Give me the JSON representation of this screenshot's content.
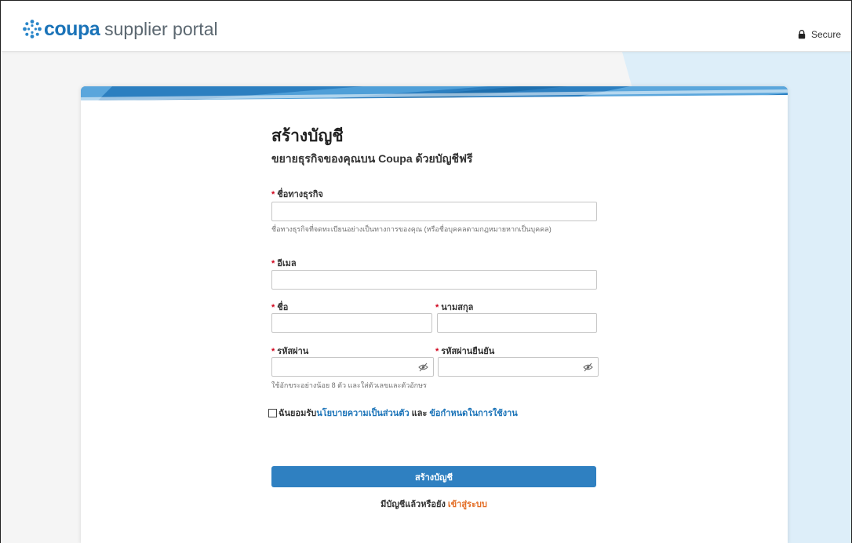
{
  "header": {
    "brand": "coupa",
    "portal": "supplier portal",
    "secure_label": "Secure"
  },
  "form": {
    "title": "สร้างบัญชี",
    "subtitle": "ขยายธุรกิจของคุณบน Coupa ด้วยบัญชีฟรี",
    "business_name_label": "ชื่อทางธุรกิจ",
    "business_name_value": "",
    "business_name_hint": "ชื่อทางธุรกิจที่จดทะเบียนอย่างเป็นทางการของคุณ (หรือชื่อบุคคลตามกฎหมายหากเป็นบุคคล)",
    "email_label": "อีเมล",
    "email_value": "",
    "first_name_label": "ชื่อ",
    "first_name_value": "",
    "last_name_label": "นามสกุล",
    "last_name_value": "",
    "password_label": "รหัสผ่าน",
    "password_value": "",
    "confirm_password_label": "รหัสผ่านยืนยัน",
    "confirm_password_value": "",
    "password_hint": "ใช้อักขระอย่างน้อย 8 ตัว และใส่ตัวเลขและตัวอักษร",
    "terms_prefix": "ฉันยอมรับ",
    "privacy_link": "นโยบายความเป็นส่วนตัว",
    "terms_and": "และ",
    "terms_link": "ข้อกำหนดในการใช้งาน",
    "terms_checked": false,
    "submit_label": "สร้างบัญชี",
    "signin_prefix": "มีบัญชีแล้วหรือยัง",
    "signin_link": "เข้าสู่ระบบ"
  },
  "icons": {
    "logo": "coupa-star-icon",
    "secure": "lock-icon",
    "password_toggle": "eye-slash-icon"
  },
  "colors": {
    "brand_blue": "#1a73b8",
    "button_blue": "#2f80c1",
    "link_orange": "#e36d25",
    "required_red": "#d0021b"
  }
}
